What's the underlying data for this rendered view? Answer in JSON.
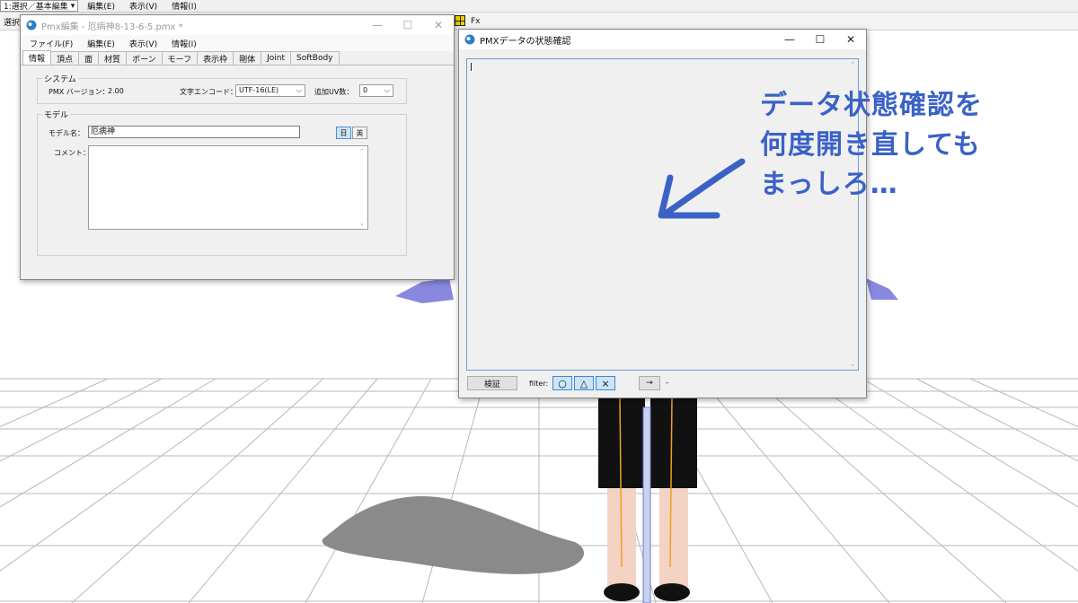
{
  "main_app": {
    "mode_select": "1:選択／基本編集",
    "menu": [
      "編集(E)",
      "表示(V)",
      "情報(I)"
    ],
    "toolbar_label": "選択",
    "fx_label": "Fx"
  },
  "pmx_editor": {
    "title": "Pmx編集 - 厄病神8-13-6-5.pmx *",
    "menu": [
      "ファイル(F)",
      "編集(E)",
      "表示(V)",
      "情報(I)"
    ],
    "tabs": [
      "情報",
      "頂点",
      "面",
      "材質",
      "ボーン",
      "モーフ",
      "表示枠",
      "剛体",
      "Joint",
      "SoftBody"
    ],
    "active_tab": "情報",
    "system": {
      "legend": "システム",
      "version_label": "PMX バージョン：",
      "version_value": "2.00",
      "encode_label": "文字エンコード：",
      "encode_value": "UTF-16(LE)",
      "uv_label": "追加UV数：",
      "uv_value": "0"
    },
    "model": {
      "legend": "モデル",
      "name_label": "モデル名：",
      "name_value": "厄病神",
      "lang_jp": "日",
      "lang_en": "英",
      "comment_label": "コメント："
    }
  },
  "pmx_check": {
    "title": "PMXデータの状態確認",
    "verify_button": "検証",
    "filter_label": "filter:",
    "filter_buttons": [
      "○",
      "△",
      "×"
    ],
    "next_button": "→",
    "status": "-"
  },
  "annotation": {
    "lines": [
      "データ状態確認を",
      "何度開き直しても",
      "まっしろ…"
    ],
    "color": "#3a62c6"
  },
  "icons": {
    "minimize": "minimize-icon",
    "maximize": "maximize-icon",
    "close": "close-icon"
  }
}
